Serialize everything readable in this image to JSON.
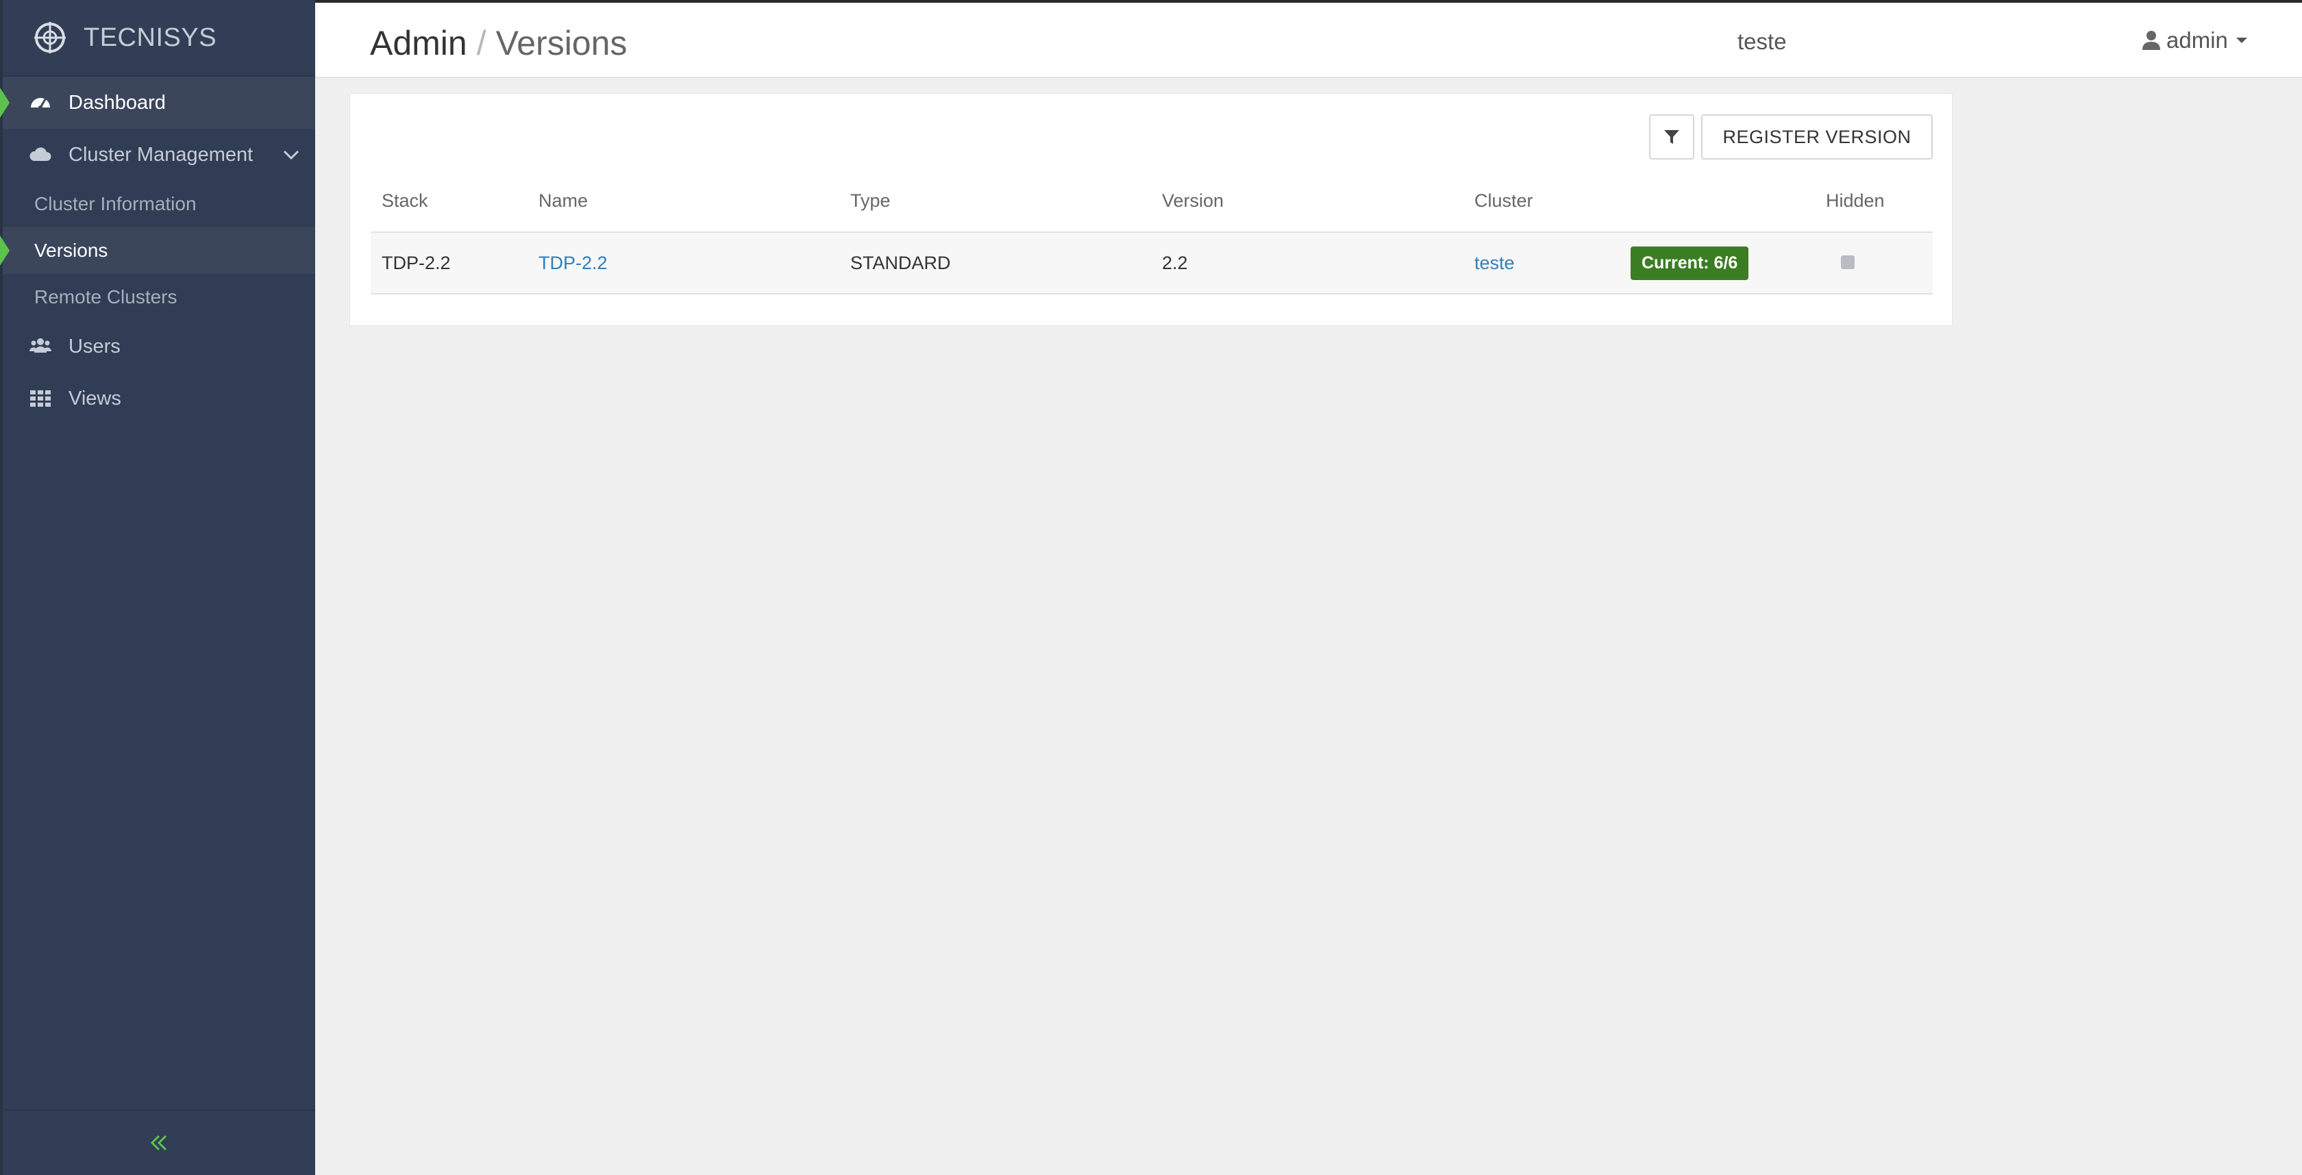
{
  "brand": {
    "name": "TECNISYS"
  },
  "sidebar": {
    "items": [
      {
        "label": "Dashboard",
        "icon": "dashboard-icon"
      },
      {
        "label": "Cluster Management",
        "icon": "cloud-icon"
      },
      {
        "label": "Users",
        "icon": "users-icon"
      },
      {
        "label": "Views",
        "icon": "grid-icon"
      }
    ],
    "subitems": [
      {
        "label": "Cluster Information"
      },
      {
        "label": "Versions"
      },
      {
        "label": "Remote Clusters"
      }
    ],
    "collapse_icon": "double-chevron-left-icon"
  },
  "header": {
    "breadcrumb_root": "Admin",
    "breadcrumb_sep": "/",
    "breadcrumb_current": "Versions",
    "cluster_link": "teste",
    "user_label": "admin"
  },
  "toolbar": {
    "register_label": "REGISTER VERSION",
    "filter_icon": "filter-icon"
  },
  "table": {
    "columns": [
      "Stack",
      "Name",
      "Type",
      "Version",
      "Cluster",
      "",
      "Hidden"
    ],
    "rows": [
      {
        "stack": "TDP-2.2",
        "name": "TDP-2.2",
        "type": "STANDARD",
        "version": "2.2",
        "cluster": "teste",
        "status": "Current: 6/6"
      }
    ]
  },
  "colors": {
    "sidebar_bg": "#313d54",
    "active_marker": "#5dc24c",
    "badge_green": "#3b7d23",
    "link_blue": "#2f7fb8"
  }
}
